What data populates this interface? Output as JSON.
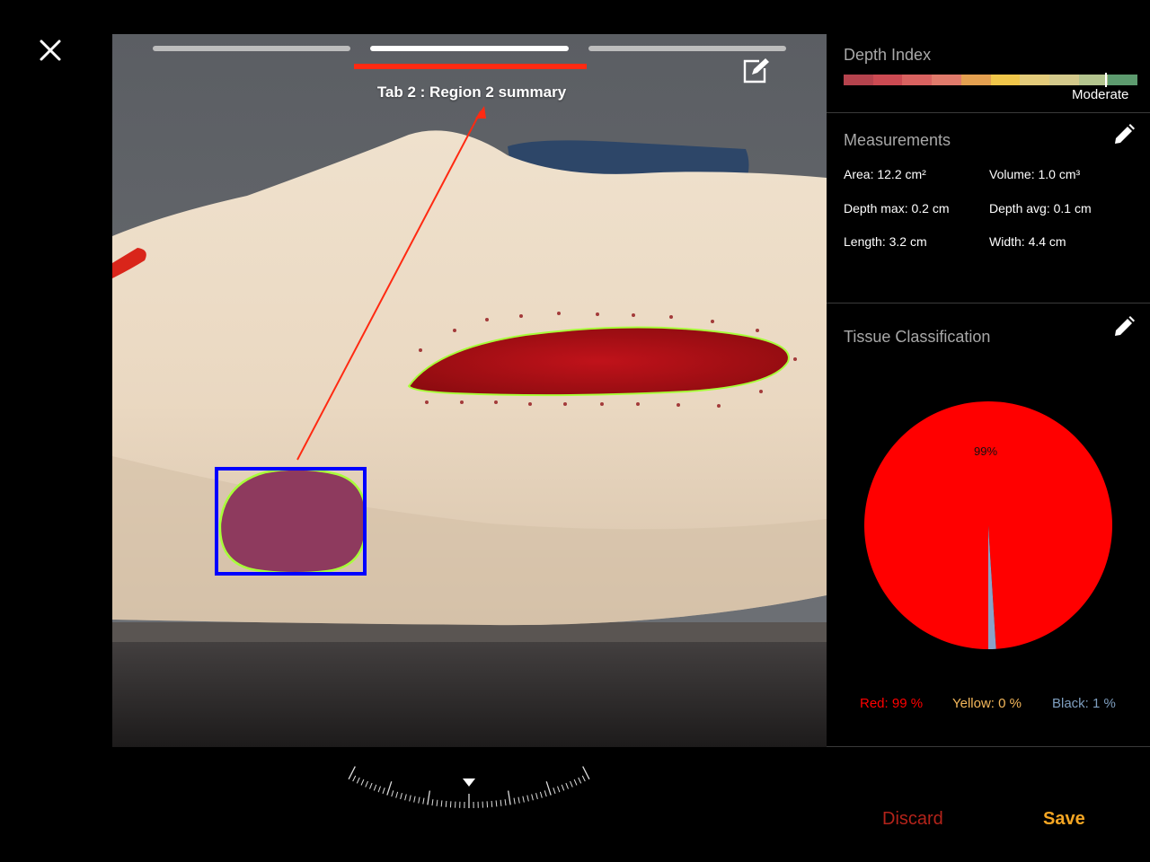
{
  "header": {
    "tab_title": "Tab 2 : Region 2 summary",
    "active_tab_index": 2,
    "tab_count": 3
  },
  "icons": {
    "close": "close-icon",
    "edit_photo": "edit-note-icon",
    "edit": "pencil-icon",
    "ruler": "rotation-dial-icon"
  },
  "depth_index": {
    "label": "Depth Index",
    "value": "Moderate",
    "marker_fraction": 0.89,
    "scale_colors": [
      "#b5434d",
      "#cc4a52",
      "#d96260",
      "#e07a6b",
      "#e4a050",
      "#f0c64a",
      "#e3cb7a",
      "#d3c98b",
      "#b3c48e",
      "#5d9b6f"
    ]
  },
  "measurements": {
    "label": "Measurements",
    "area": "Area: 12.2 cm²",
    "volume": "Volume: 1.0 cm³",
    "depth_max": "Depth max: 0.2 cm",
    "depth_avg": "Depth avg: 0.1 cm",
    "length": "Length: 3.2 cm",
    "width": "Width: 4.4 cm"
  },
  "tissue": {
    "label": "Tissue Classification",
    "legend_red": "Red: 99 %",
    "legend_yellow": "Yellow: 0 %",
    "legend_black": "Black: 1 %",
    "colors": {
      "red": "#ff0000",
      "yellow": "#f5b85b",
      "black": "#7f9fc0"
    }
  },
  "chart_data": {
    "type": "pie",
    "slices": [
      {
        "name": "Red",
        "value": 99,
        "color": "#ff0000"
      },
      {
        "name": "Yellow",
        "value": 0,
        "color": "#f5b85b"
      },
      {
        "name": "Black",
        "value": 1,
        "color": "#8aa2c8"
      }
    ],
    "labels": [
      "99%"
    ]
  },
  "actions": {
    "discard": "Discard",
    "save": "Save"
  },
  "colors": {
    "accent_save": "#f5a623",
    "discard": "#b3231a",
    "annotation_red": "#ff2a12",
    "selection_blue": "#0000ff",
    "outline_green": "#a8ff3a"
  }
}
